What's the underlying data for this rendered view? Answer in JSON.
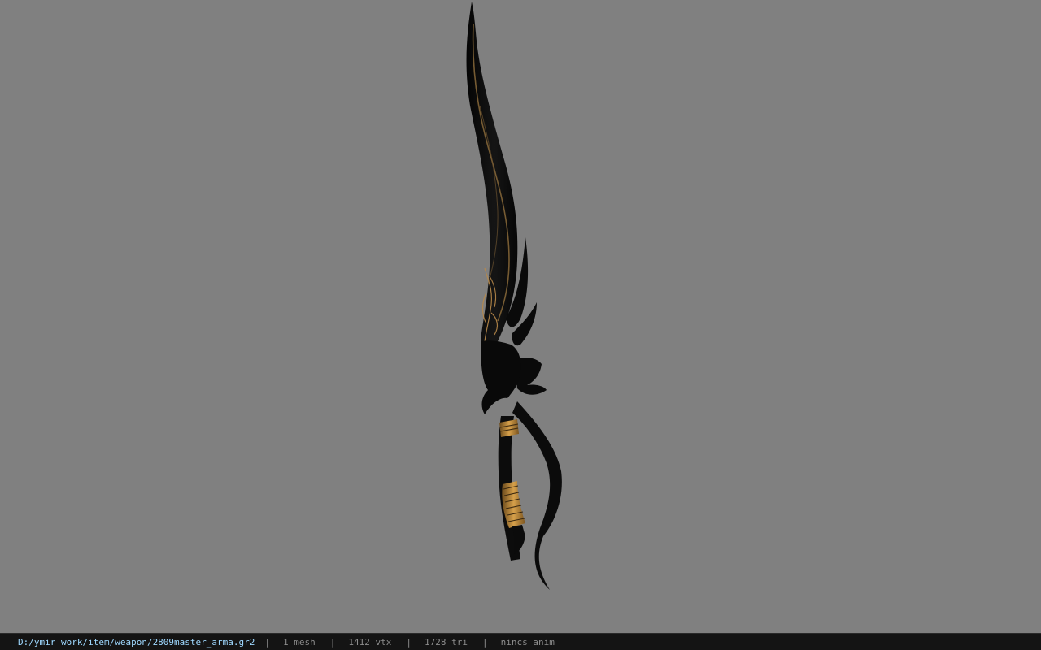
{
  "status_bar": {
    "file_path": "D:/ymir work/item/weapon/2809master_arma.gr2",
    "separator": "|",
    "mesh_count": "1 mesh",
    "vertex_count": "1412 vtx",
    "triangle_count": "1728 tri",
    "animation": "nincs anim"
  },
  "viewport": {
    "background_color": "#808080",
    "model": "weapon-model",
    "blade_color": "#0b0b0b",
    "trim_color": "#c9a063"
  }
}
